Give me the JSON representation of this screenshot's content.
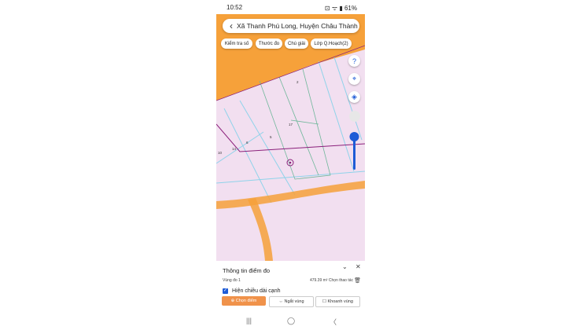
{
  "status_bar": {
    "time": "10:52",
    "battery": "61%",
    "right_icons": "⊡ ᯤ ▮ 61%"
  },
  "search": {
    "title": "Xã Thanh Phú Long, Huyện Châu Thành"
  },
  "toolbar": {
    "items": [
      "Kiểm tra số",
      "Thước đo",
      "Chú giải",
      "Lớp Q.Hoạch(2)"
    ]
  },
  "map": {
    "parcel_labels": [
      "2",
      "17",
      "5",
      "6",
      "14",
      "10"
    ],
    "colors": {
      "zone": "#f2dff0",
      "road": "#f6a13a",
      "water_line": "#8fd3ea",
      "boundary": "#8a1f7a",
      "parcel": "#6fb79a"
    }
  },
  "fabs": {
    "help": "?",
    "compass": "⌖",
    "layers": "◈"
  },
  "sheet": {
    "title": "Thông tin điểm đo",
    "area_name": "Vùng đo 1",
    "area_value": "479.39 m²",
    "area_action": "Chọn thao tác",
    "checkbox_label": "Hiện chiều dài cạnh",
    "buttons": {
      "select_point": "⊕ Chọn điểm",
      "disconnect": "⇔ Ngắt vùng",
      "close_area": "☐ Khoanh vùng"
    }
  },
  "navbar": {
    "recent": "|||",
    "home": "◯",
    "back": "〈"
  }
}
